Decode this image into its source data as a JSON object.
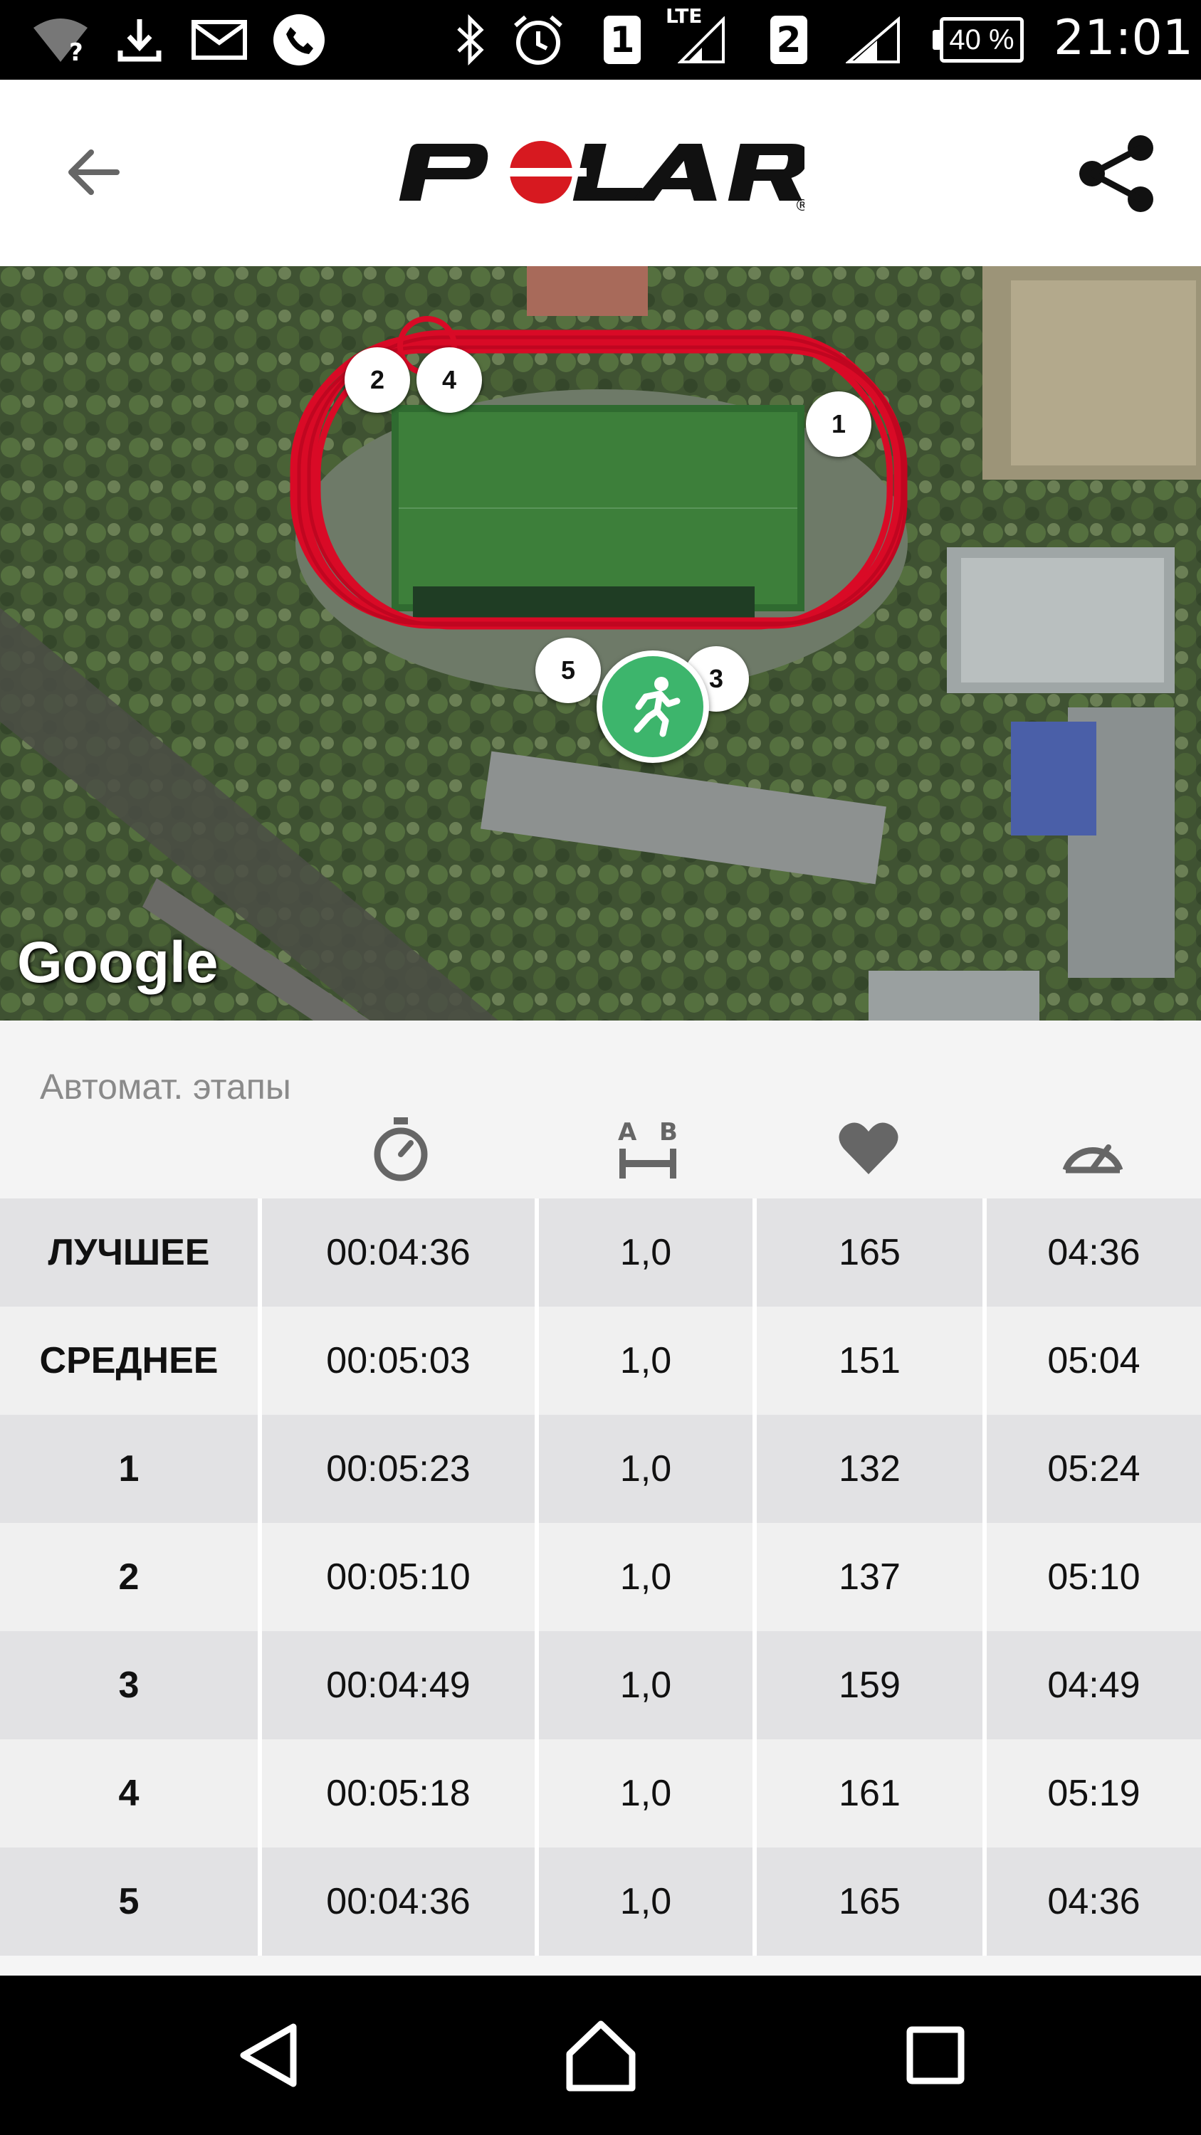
{
  "status_bar": {
    "sim1": "1",
    "sim2": "2",
    "network": "LTE",
    "battery": "40 %",
    "time": "21:01",
    "icons": [
      "wifi-unknown-icon",
      "download-icon",
      "mail-icon",
      "phone-icon",
      "bluetooth-icon",
      "alarm-icon",
      "signal-icon"
    ]
  },
  "app_bar": {
    "logo": "POLAR",
    "icons": [
      "back-arrow-icon",
      "share-icon"
    ]
  },
  "map": {
    "attribution": "Google",
    "lap_markers": [
      "1",
      "2",
      "3",
      "4",
      "5"
    ],
    "route_color": "#d90a26",
    "start_color": "#3db56c"
  },
  "laps": {
    "title": "Автомат. этапы",
    "column_icons": [
      "stopwatch-icon",
      "distance-icon",
      "heart-icon",
      "speedometer-icon"
    ],
    "distance_icon_labels": {
      "a": "A",
      "b": "B"
    },
    "rows": [
      {
        "label": "ЛУЧШЕЕ",
        "time": "00:04:36",
        "distance": "1,0",
        "hr": "165",
        "pace": "04:36"
      },
      {
        "label": "СРЕДНЕЕ",
        "time": "00:05:03",
        "distance": "1,0",
        "hr": "151",
        "pace": "05:04"
      },
      {
        "label": "1",
        "time": "00:05:23",
        "distance": "1,0",
        "hr": "132",
        "pace": "05:24"
      },
      {
        "label": "2",
        "time": "00:05:10",
        "distance": "1,0",
        "hr": "137",
        "pace": "05:10"
      },
      {
        "label": "3",
        "time": "00:04:49",
        "distance": "1,0",
        "hr": "159",
        "pace": "04:49"
      },
      {
        "label": "4",
        "time": "00:05:18",
        "distance": "1,0",
        "hr": "161",
        "pace": "05:19"
      },
      {
        "label": "5",
        "time": "00:04:36",
        "distance": "1,0",
        "hr": "165",
        "pace": "04:36"
      }
    ]
  },
  "nav_bar": {
    "icons": [
      "nav-back-icon",
      "nav-home-icon",
      "nav-recents-icon"
    ]
  }
}
